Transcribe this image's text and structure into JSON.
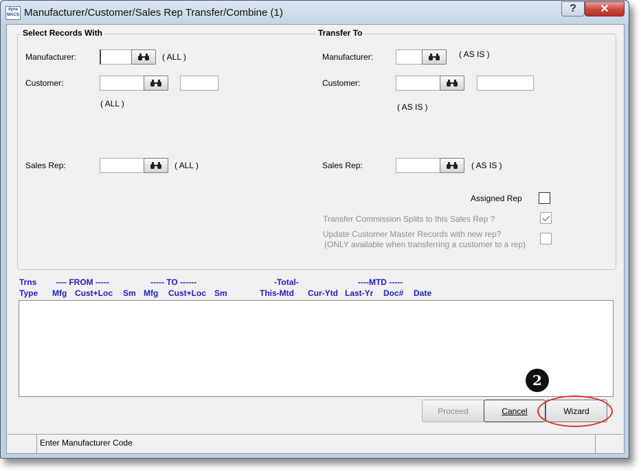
{
  "window": {
    "title": "Manufacturer/Customer/Sales Rep Transfer/Combine (1)",
    "logo_text": "dyna MACS",
    "help_label": "?",
    "close_label": "✕"
  },
  "select": {
    "legend": "Select Records With",
    "manufacturer_label": "Manufacturer:",
    "manufacturer_value": "",
    "manufacturer_hint": "( ALL )",
    "customer_label": "Customer:",
    "customer_value": "",
    "customer_loc_value": "",
    "customer_hint": "( ALL )",
    "salesrep_label": "Sales Rep:",
    "salesrep_value": "",
    "salesrep_hint": "( ALL )"
  },
  "transfer": {
    "legend": "Transfer To",
    "manufacturer_label": "Manufacturer:",
    "manufacturer_value": "",
    "manufacturer_hint": "( AS IS )",
    "customer_label": "Customer:",
    "customer_value": "",
    "customer_loc_value": "",
    "customer_hint": "( AS IS )",
    "salesrep_label": "Sales Rep:",
    "salesrep_value": "",
    "salesrep_hint": "( AS IS )",
    "assigned_rep_label": "Assigned Rep",
    "assigned_rep_checked": false,
    "commission_label": "Transfer Commission Splits to this Sales Rep ?",
    "commission_checked": true,
    "update_master_label": "Update Customer Master Records with new rep?",
    "update_master_note": "(ONLY available when transferring a customer to a rep)",
    "update_master_checked": false
  },
  "grid": {
    "header_row1": {
      "trns": "Trns",
      "from": "---- FROM -----",
      "to": "----- TO ------",
      "total": "-Total-",
      "mtd": "----MTD -----"
    },
    "header_row2": {
      "type": "Type",
      "mfg_from": "Mfg",
      "custloc_from": "Cust+Loc",
      "sm_from": "Sm",
      "mfg_to": "Mfg",
      "custloc_to": "Cust+Loc",
      "sm_to": "Sm",
      "this_mtd": "This-Mtd",
      "cur_ytd": "Cur-Ytd",
      "last_yr": "Last-Yr",
      "doc": "Doc#",
      "date": "Date"
    },
    "rows": []
  },
  "buttons": {
    "proceed": "Proceed",
    "cancel": "Cancel",
    "wizard": "Wizard"
  },
  "annotation": {
    "step": "2"
  },
  "status": {
    "message": "Enter Manufacturer Code"
  },
  "colors": {
    "header_blue": "#2020c0",
    "highlight_red": "#d33333"
  }
}
